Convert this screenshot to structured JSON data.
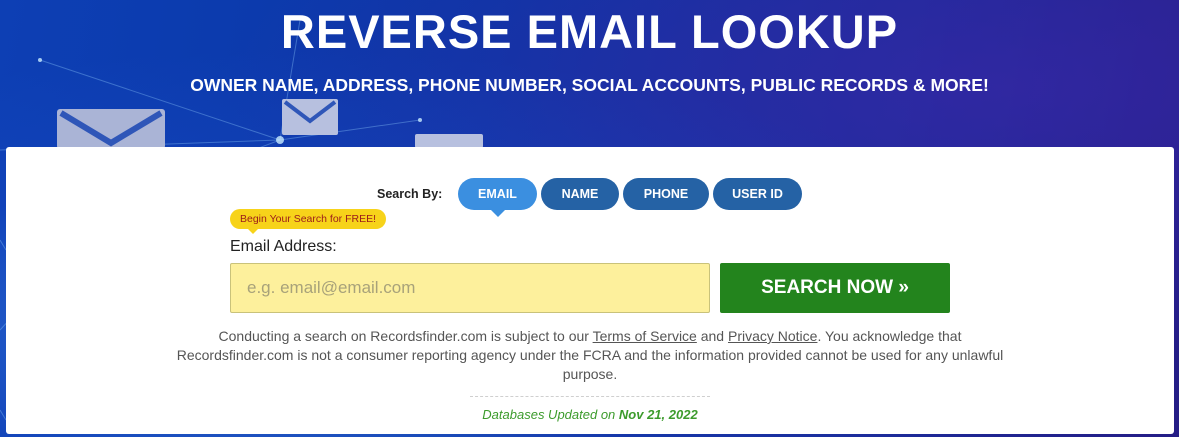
{
  "hero": {
    "title": "REVERSE EMAIL LOOKUP",
    "subtitle": "OWNER NAME, ADDRESS, PHONE NUMBER, SOCIAL ACCOUNTS, PUBLIC RECORDS & MORE!"
  },
  "search": {
    "search_by_label": "Search By:",
    "tabs": [
      {
        "label": "EMAIL",
        "active": true
      },
      {
        "label": "NAME",
        "active": false
      },
      {
        "label": "PHONE",
        "active": false
      },
      {
        "label": "USER ID",
        "active": false
      }
    ],
    "badge": "Begin Your Search for FREE!",
    "field_label": "Email Address:",
    "input_value": "",
    "input_placeholder": "e.g. email@email.com",
    "button_label": "SEARCH NOW »"
  },
  "disclaimer": {
    "part1": "Conducting a search on Recordsfinder.com is subject to our ",
    "terms_link": "Terms of Service",
    "and": " and ",
    "privacy_link": "Privacy Notice",
    "part2": ". You acknowledge that Recordsfinder.com is not a consumer reporting agency under the FCRA and the information provided cannot be used for any unlawful purpose."
  },
  "updated": {
    "label": "Databases Updated on ",
    "date": "Nov 21, 2022"
  },
  "colors": {
    "tab_active": "#3b8fe0",
    "tab": "#2562a5",
    "search_button": "#23841d",
    "input_bg": "#fdf09c",
    "badge_bg": "#f7d31a",
    "updated_text": "#3c9b2c"
  },
  "icons": [
    "envelope-icon",
    "chevrons-right-icon"
  ]
}
